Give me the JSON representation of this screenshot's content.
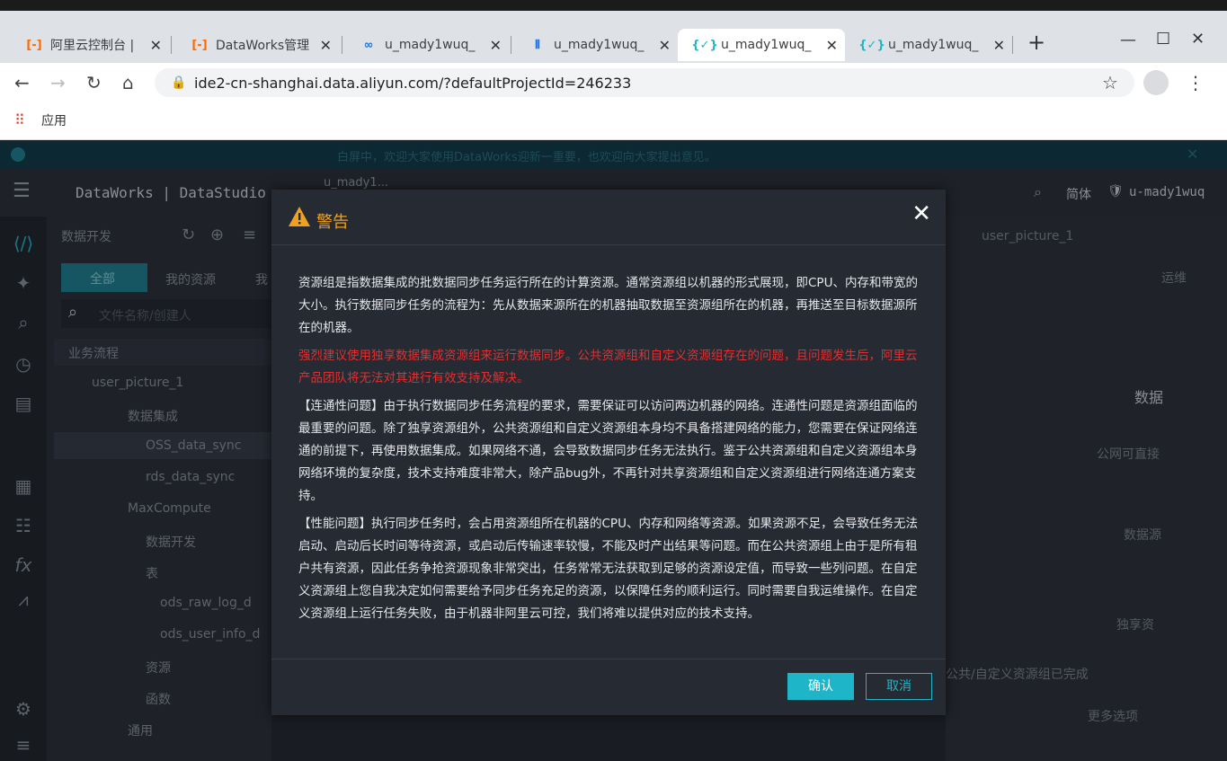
{
  "browser": {
    "tabs": [
      {
        "label": "阿里云控制台 |",
        "icon": "aliyun-icon"
      },
      {
        "label": "DataWorks管理",
        "icon": "aliyun-icon"
      },
      {
        "label": "u_mady1wuq_",
        "icon": "cloud-icon"
      },
      {
        "label": "u_mady1wuq_",
        "icon": "dataworks-icon"
      },
      {
        "label": "u_mady1wuq_",
        "icon": "code-icon"
      },
      {
        "label": "u_mady1wuq_",
        "icon": "code-icon"
      }
    ],
    "url": "ide2-cn-shanghai.data.aliyun.com/?defaultProjectId=246233",
    "bookmark_apps": "应用"
  },
  "app": {
    "notice": "白屏中，欢迎大家使用DataWorks迎新一重要，也欢迎向大家提出意见。",
    "brand": "DataWorks | DataStudio",
    "user_tag": "u_mady1...",
    "header_right": {
      "lang": "简体",
      "user": "u-mady1wuq"
    },
    "sidebar": {
      "title": "数据开发",
      "tabs": [
        "全部",
        "我的资源",
        "我"
      ],
      "search_placeholder": "文件名称/创建人",
      "tree": [
        {
          "label": "业务流程"
        },
        {
          "label": "user_picture_1"
        },
        {
          "label": "数据集成"
        },
        {
          "label": "OSS_data_sync"
        },
        {
          "label": "rds_data_sync"
        },
        {
          "label": "MaxCompute"
        },
        {
          "label": "数据开发"
        },
        {
          "label": "表"
        },
        {
          "label": "ods_raw_log_d"
        },
        {
          "label": "ods_user_info_d"
        },
        {
          "label": "资源"
        },
        {
          "label": "函数"
        },
        {
          "label": "通用"
        }
      ]
    },
    "right_panel": {
      "tab": "user_picture_1",
      "ops": "运维",
      "data_label": "数据",
      "public_network": "公网可直接",
      "datasource": "数据源",
      "more": "更多选项",
      "exclusive": "独享资",
      "status": "公共/自定义资源组已完成"
    }
  },
  "dialog": {
    "title": "警告",
    "paragraphs": [
      "资源组是指数据集成的批数据同步任务运行所在的计算资源。通常资源组以机器的形式展现，即CPU、内存和带宽的大小。执行数据同步任务的流程为：先从数据来源所在的机器抽取数据至资源组所在的机器，再推送至目标数据源所在的机器。",
      "强烈建议使用独享数据集成资源组来运行数据同步。公共资源组和自定义资源组存在的问题，且问题发生后，阿里云产品团队将无法对其进行有效支持及解决。",
      "【连通性问题】由于执行数据同步任务流程的要求，需要保证可以访问两边机器的网络。连通性问题是资源组面临的最重要的问题。除了独享资源组外，公共资源组和自定义资源组本身均不具备搭建网络的能力，您需要在保证网络连通的前提下，再使用数据集成。如果网络不通，会导致数据同步任务无法执行。鉴于公共资源组和自定义资源组本身网络环境的复杂度，技术支持难度非常大，除产品bug外，不再针对共享资源组和自定义资源组进行网络连通方案支持。",
      "【性能问题】执行同步任务时，会占用资源组所在机器的CPU、内存和网络等资源。如果资源不足，会导致任务无法启动、启动后长时间等待资源，或启动后传输速率较慢，不能及时产出结果等问题。而在公共资源组上由于是所有租户共有资源，因此任务争抢资源现象非常突出，任务常常无法获取到足够的资源设定值，而导致一些列问题。在自定义资源组上您自我决定如何需要给予同步任务充足的资源，以保障任务的顺利运行。同时需要自我运维操作。在自定义资源组上运行任务失败，由于机器非阿里云可控，我们将难以提供对应的技术支持。"
    ],
    "confirm": "确认",
    "cancel": "取消"
  },
  "colors": {
    "accent": "#1fb5c8",
    "warning": "#f0a020",
    "danger": "#e03030"
  }
}
